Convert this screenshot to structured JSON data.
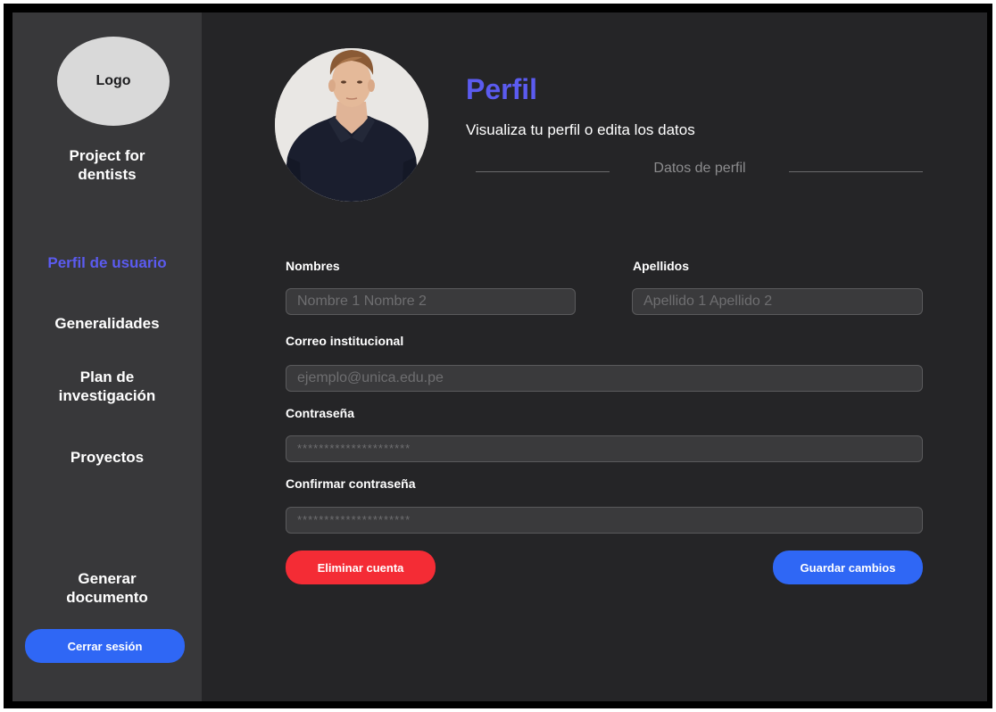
{
  "sidebar": {
    "logo_text": "Logo",
    "app_name": "Project for\ndentists",
    "nav": [
      {
        "label": "Perfil de usuario",
        "active": true
      },
      {
        "label": "Generalidades",
        "active": false
      },
      {
        "label": "Plan de\ninvestigación",
        "active": false
      },
      {
        "label": "Proyectos",
        "active": false
      },
      {
        "label": "Generar\ndocumento",
        "active": false
      }
    ],
    "logout_label": "Cerrar sesión"
  },
  "header": {
    "title": "Perfil",
    "subtitle": "Visualiza tu perfil o edita los datos",
    "section_label": "Datos de perfil"
  },
  "form": {
    "first_names": {
      "label": "Nombres",
      "placeholder": "Nombre 1 Nombre 2",
      "value": ""
    },
    "last_names": {
      "label": "Apellidos",
      "placeholder": "Apellido 1 Apellido 2",
      "value": ""
    },
    "email": {
      "label": "Correo institucional",
      "placeholder": "ejemplo@unica.edu.pe",
      "value": ""
    },
    "password": {
      "label": "Contraseña",
      "placeholder": "*********************",
      "value": ""
    },
    "confirm_password": {
      "label": "Confirmar contraseña",
      "placeholder": "*********************",
      "value": ""
    }
  },
  "actions": {
    "delete_label": "Eliminar cuenta",
    "save_label": "Guardar cambios"
  },
  "colors": {
    "accent": "#5b5bf0",
    "primary_button": "#2f67f5",
    "danger_button": "#f42c35",
    "sidebar_bg": "#38383a",
    "main_bg": "#252527"
  }
}
